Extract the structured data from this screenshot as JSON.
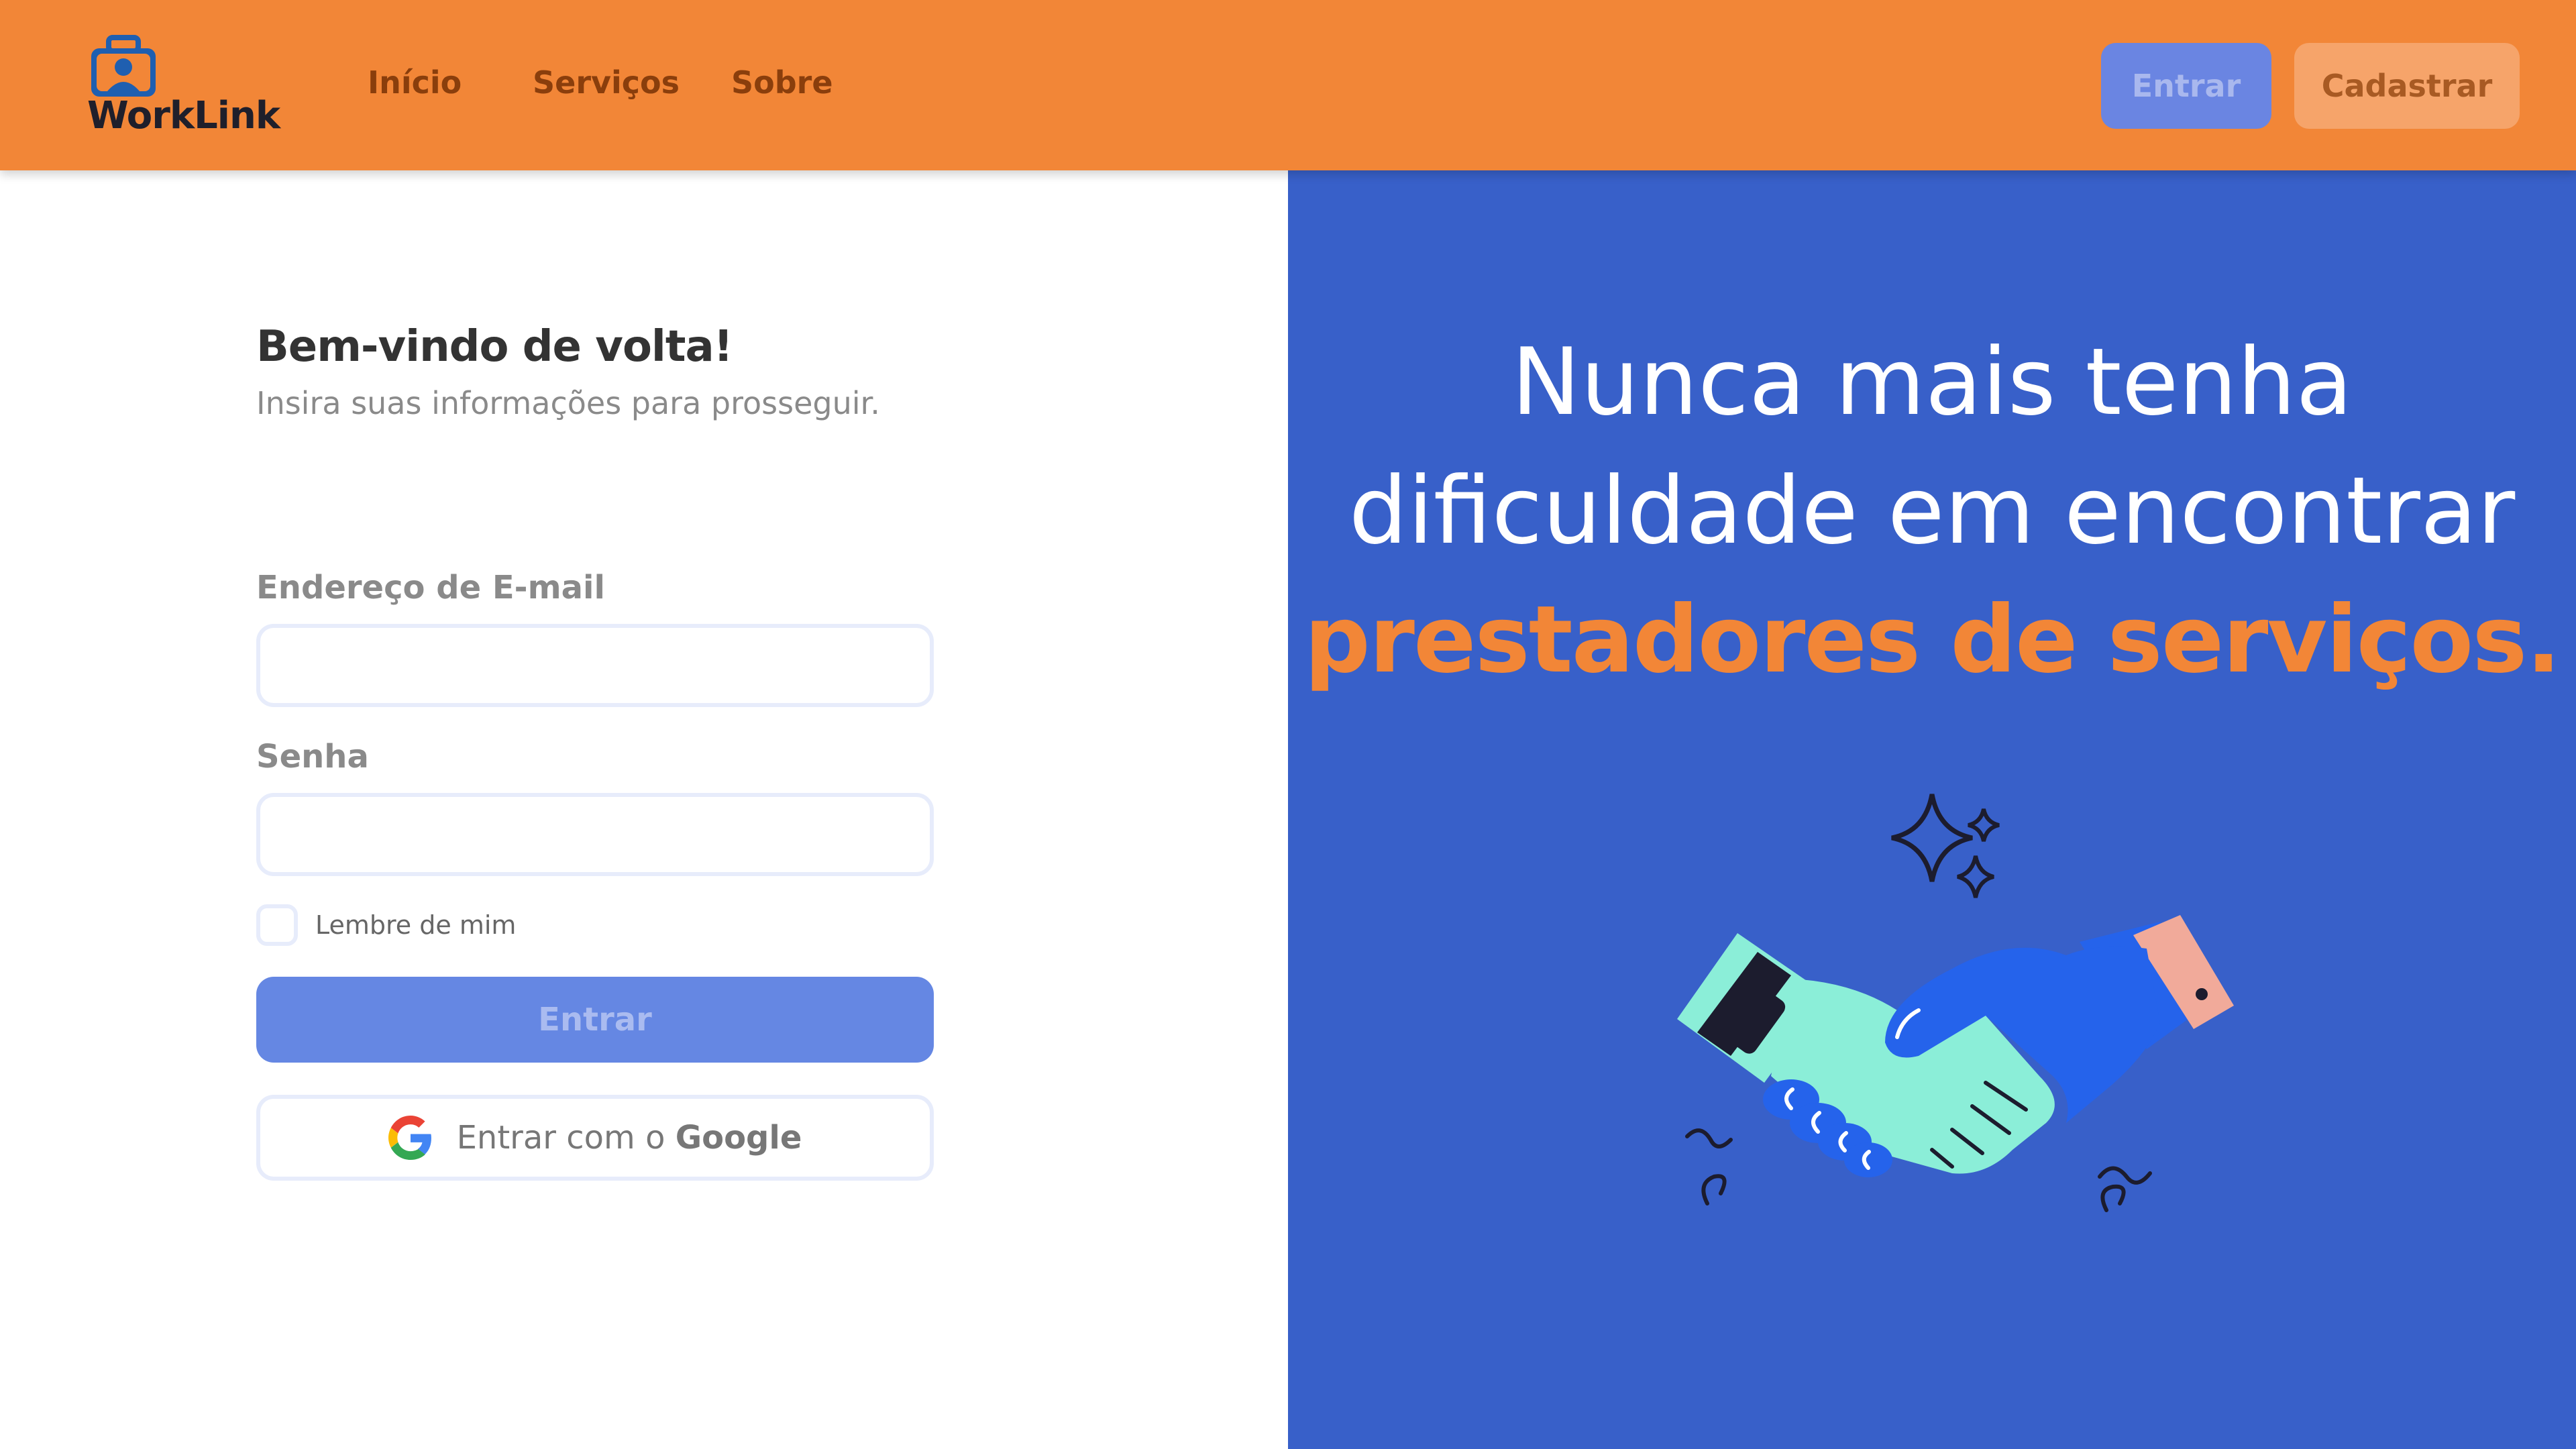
{
  "header": {
    "logo_text": "WorkLink",
    "nav": [
      "Início",
      "Serviços",
      "Sobre"
    ],
    "login_button": "Entrar",
    "signup_button": "Cadastrar"
  },
  "login": {
    "title": "Bem-vindo de volta!",
    "subtitle": "Insira suas informações para prosseguir.",
    "email_label": "Endereço de E-mail",
    "email_value": "",
    "password_label": "Senha",
    "password_value": "",
    "remember_label": "Lembre de mim",
    "remember_checked": false,
    "submit_button": "Entrar",
    "google_prefix": "Entrar com o ",
    "google_brand": "Google"
  },
  "hero": {
    "line1": "Nunca mais tenha",
    "line2": "dificuldade em encontrar",
    "line3": "prestadores de serviços."
  },
  "colors": {
    "header": "#f28637",
    "accent_orange": "#f28637",
    "panel_blue": "#3860c9",
    "button_blue": "#6587e3"
  },
  "icons": [
    "briefcase-user-icon",
    "google-icon",
    "handshake-illustration"
  ]
}
